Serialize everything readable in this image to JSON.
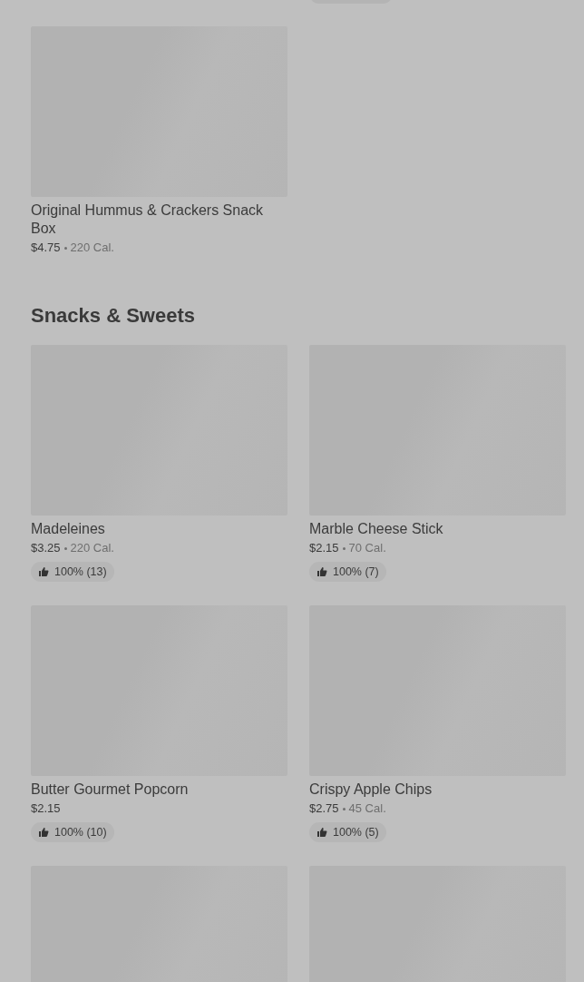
{
  "cut_off_badge": true,
  "sections": [
    {
      "items": [
        {
          "kind": "product",
          "name": "Original Hummus & Crackers Snack Box",
          "price": "$4.75",
          "calories": "220 Cal."
        }
      ]
    },
    {
      "title": "Snacks & Sweets",
      "items": [
        {
          "kind": "product",
          "name": "Madeleines",
          "price": "$3.25",
          "calories": "220 Cal.",
          "rating": "100% (13)"
        },
        {
          "kind": "product",
          "name": "Marble Cheese Stick",
          "price": "$2.15",
          "calories": "70 Cal.",
          "rating": "100% (7)"
        },
        {
          "kind": "product",
          "name": "Butter Gourmet Popcorn",
          "price": "$2.15",
          "rating": "100% (10)"
        },
        {
          "kind": "product",
          "name": "Crispy Apple Chips",
          "price": "$2.75",
          "calories": "45 Cal.",
          "rating": "100% (5)"
        },
        {
          "kind": "picture"
        },
        {
          "kind": "picture"
        }
      ]
    }
  ]
}
